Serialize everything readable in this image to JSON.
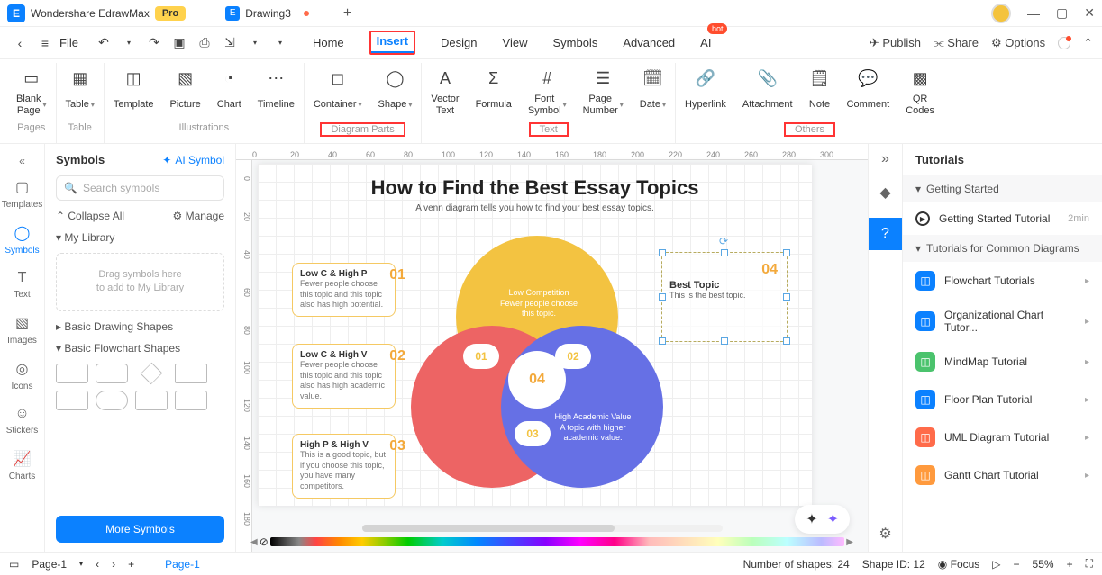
{
  "titlebar": {
    "app": "Wondershare EdrawMax",
    "pro": "Pro",
    "tab": "Drawing3"
  },
  "menubar": {
    "file": "File",
    "tabs": [
      "Home",
      "Insert",
      "Design",
      "View",
      "Symbols",
      "Advanced",
      "AI"
    ],
    "hot": "hot",
    "publish": "Publish",
    "share": "Share",
    "options": "Options"
  },
  "ribbon": {
    "pages_group": "Pages",
    "table_group": "Table",
    "illus_group": "Illustrations",
    "diagram_group": "Diagram Parts",
    "text_group": "Text",
    "others_group": "Others",
    "blank": "Blank\nPage",
    "table": "Table",
    "template": "Template",
    "picture": "Picture",
    "chart": "Chart",
    "timeline": "Timeline",
    "container": "Container",
    "shape": "Shape",
    "vector": "Vector\nText",
    "formula": "Formula",
    "font": "Font\nSymbol",
    "pagenum": "Page\nNumber",
    "date": "Date",
    "hyperlink": "Hyperlink",
    "attach": "Attachment",
    "note": "Note",
    "comment": "Comment",
    "qr": "QR\nCodes"
  },
  "symbols": {
    "title": "Symbols",
    "ai": "AI Symbol",
    "search": "Search symbols",
    "collapse": "Collapse All",
    "manage": "Manage",
    "mylib": "My Library",
    "drop1": "Drag symbols here",
    "drop2": "to add to My Library",
    "basic": "Basic Drawing Shapes",
    "flow": "Basic Flowchart Shapes",
    "more": "More Symbols"
  },
  "rail": [
    "Templates",
    "Symbols",
    "Text",
    "Images",
    "Icons",
    "Stickers",
    "Charts"
  ],
  "diagram": {
    "title": "How to Find the Best Essay Topics",
    "subtitle": "A venn diagram tells you how to find your best essay topics.",
    "venn1": "Low Competition\nFewer people choose this topic.",
    "venn2": "High Academic Value\nA topic with higher academic value.",
    "center": "04",
    "n01": "01",
    "n02": "02",
    "n03": "03",
    "co1t": "Low C & High P",
    "co1d": "Fewer people choose this topic and this topic also has high potential.",
    "co1n": "01",
    "co2t": "Low C & High V",
    "co2d": "Fewer people choose this topic and this topic also has high academic value.",
    "co2n": "02",
    "co3t": "High P & High V",
    "co3d": "This is a good topic, but if you choose this topic, you have many competitors.",
    "co3n": "03",
    "selt": "Best Topic",
    "seld": "This is the best topic.",
    "seln": "04"
  },
  "tutorials": {
    "title": "Tutorials",
    "s1": "Getting Started",
    "s2": "Tutorials for Common Diagrams",
    "started": "Getting Started Tutorial",
    "started_time": "2min",
    "items": [
      {
        "label": "Flowchart Tutorials",
        "color": "#0b81ff"
      },
      {
        "label": "Organizational Chart Tutor...",
        "color": "#0b81ff"
      },
      {
        "label": "MindMap Tutorial",
        "color": "#4bc36d"
      },
      {
        "label": "Floor Plan Tutorial",
        "color": "#0b81ff"
      },
      {
        "label": "UML Diagram Tutorial",
        "color": "#ff6b4a"
      },
      {
        "label": "Gantt Chart Tutorial",
        "color": "#ff9a3d"
      }
    ]
  },
  "status": {
    "page": "Page-1",
    "page2": "Page-1",
    "shapes": "Number of shapes: 24",
    "shapeid": "Shape ID: 12",
    "focus": "Focus",
    "zoom": "55%"
  }
}
